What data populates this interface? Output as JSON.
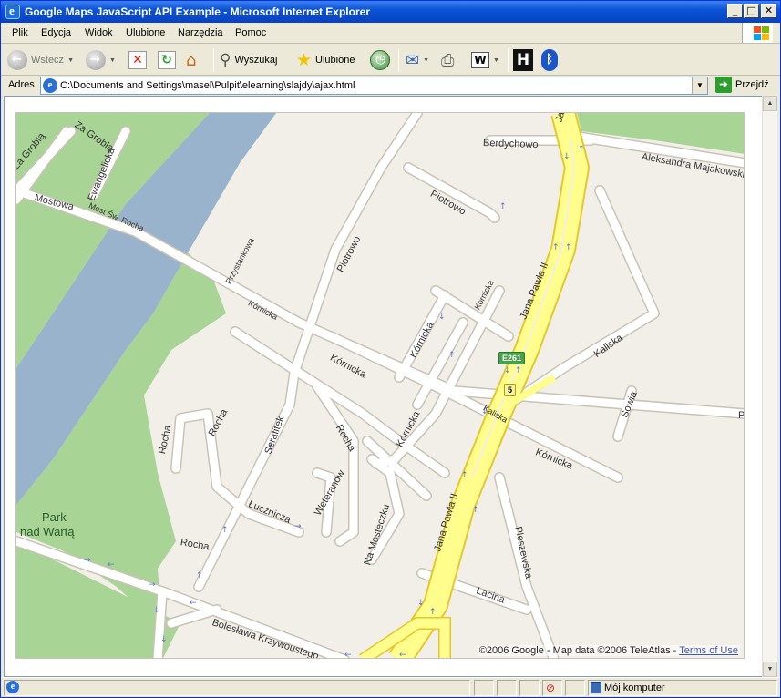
{
  "window": {
    "title": "Google Maps JavaScript API Example - Microsoft Internet Explorer",
    "minimize": "_",
    "maximize": "□",
    "close": "✕"
  },
  "menu": {
    "items": [
      "Plik",
      "Edycja",
      "Widok",
      "Ulubione",
      "Narzędzia",
      "Pomoc"
    ]
  },
  "toolbar": {
    "back_label": "Wstecz",
    "search_label": "Wyszukaj",
    "favorites_label": "Ulubione",
    "icons": [
      "back-icon",
      "forward-icon",
      "stop-icon",
      "refresh-icon",
      "home-icon",
      "search-icon",
      "favorites-icon",
      "history-icon",
      "mail-icon",
      "print-icon",
      "edit-icon",
      "h-icon",
      "bluetooth-icon"
    ]
  },
  "address": {
    "label": "Adres",
    "url": "C:\\Documents and Settings\\masel\\Pulpit\\elearning\\slajdy\\ajax.html",
    "go_label": "Przejdź"
  },
  "map": {
    "colors": {
      "land": "#f2efe9",
      "river": "#99b3cc",
      "park": "#a8d496",
      "road": "#ffffff",
      "highway": "#fffd8b",
      "highway_casing": "#e5c82a"
    },
    "labels": {
      "za_grobla_1": "Za Groblą",
      "za_grobla_2": "Za Groblą",
      "ewangelicka": "Ewangelicka",
      "mostowa": "Mostowa",
      "most_sw_rocha": "Most Św. Rocha",
      "przystankowa": "Przystankowa",
      "kornicka_1": "Kórnicka",
      "kornicka_2": "Kórnicka",
      "kornicka_3": "Kórnicka",
      "kornicka_4": "Kórnicka",
      "kornicka_5": "Kórnicka",
      "kornicka_6": "Kórnicka",
      "piotrowo_1": "Piotrowo",
      "piotrowo_2": "Piotrowo",
      "berdychowo": "Berdychowo",
      "aleksandra": "Aleksandra Majakowskiego",
      "jana_pawla_1": "Jana Pawła II",
      "jana_pawla_2": "Jana Pawła II",
      "jana_pawla_3": "Jana Pawła II",
      "kaliska_1": "Kaliska",
      "kaliska_2": "Kaliska",
      "sowia": "Sowia",
      "rocha_1": "Rocha",
      "rocha_2": "Rocha",
      "rocha_3": "Rocha",
      "rocha_4": "Rocha",
      "serafitek": "Serafitek",
      "weteranow": "Weteranów",
      "lucznicza": "Łucznicza",
      "na_mosteczku": "Na Mosteczku",
      "pleszewska": "Pleszewska",
      "lacina": "Łacina",
      "boleslawa": "Bolesława Krzywoustego",
      "park_1": "Park",
      "park_2": "nad Wartą",
      "edge_p": "P"
    },
    "shield_e261": "E261",
    "shield_5": "5",
    "copyright_text": "©2006 Google - Map data ©2006 TeleAtlas - ",
    "terms_link": "Terms of Use"
  },
  "status": {
    "zone": "Mój komputer"
  }
}
